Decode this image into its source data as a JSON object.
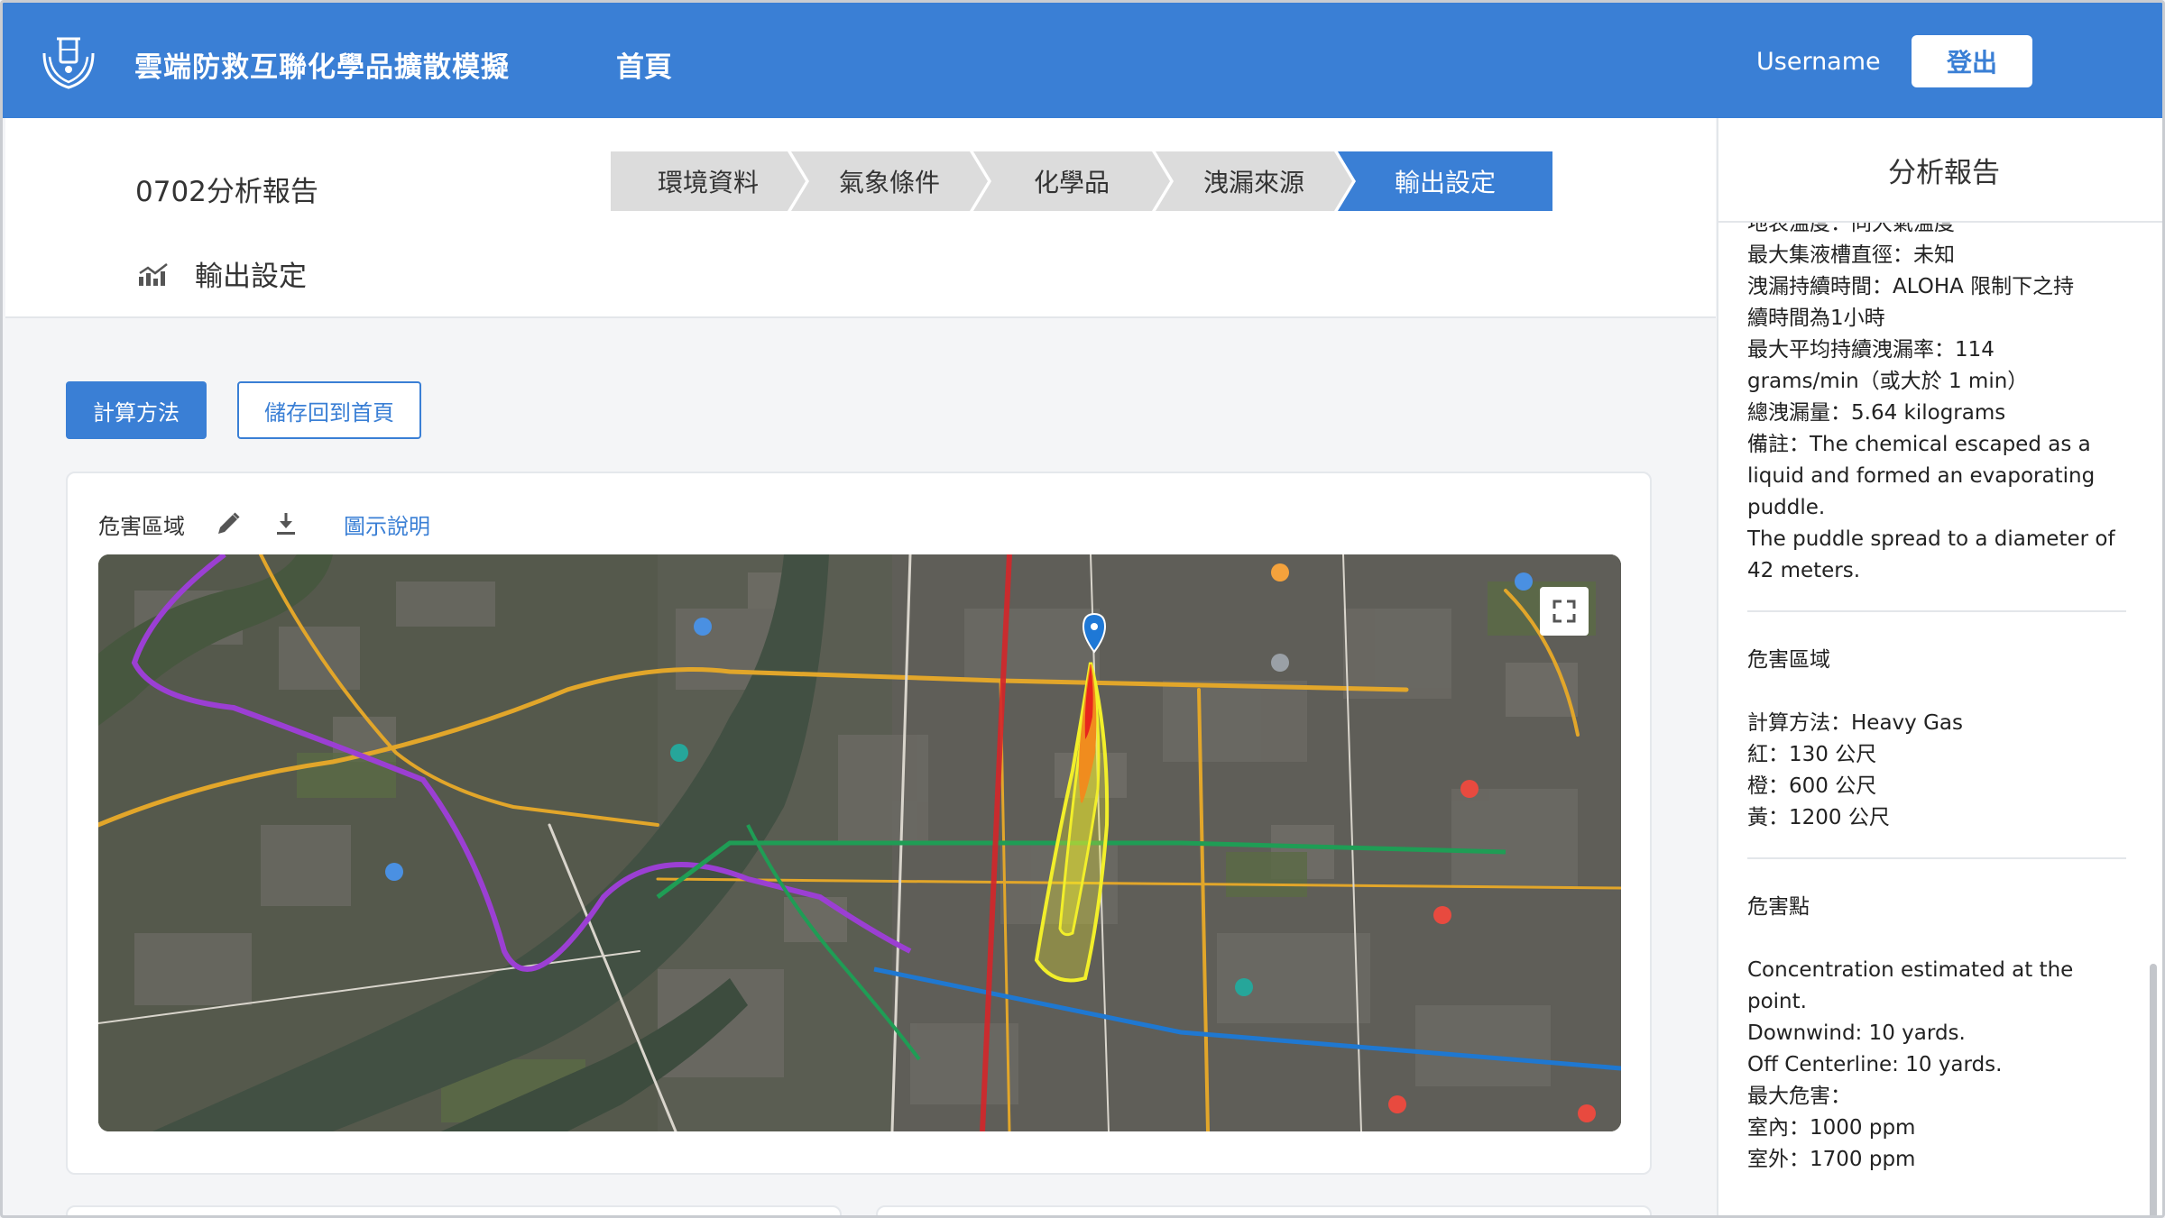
{
  "header": {
    "app_title": "雲端防救互聯化學品擴散模擬",
    "nav_home": "首頁",
    "username": "Username",
    "logout": "登出"
  },
  "page": {
    "report_title": "0702分析報告",
    "section_title": "輸出設定"
  },
  "stepper": {
    "steps": [
      "環境資料",
      "氣象條件",
      "化學品",
      "洩漏來源",
      "輸出設定"
    ],
    "active_index": 4
  },
  "actions": {
    "calc_method": "計算方法",
    "save_home": "儲存回到首頁"
  },
  "map_card": {
    "label": "危害區域",
    "legend_link": "圖示說明",
    "icons": [
      "edit-icon",
      "download-icon",
      "fullscreen-icon"
    ]
  },
  "report_panel": {
    "title": "分析報告",
    "source_lines": [
      "地表溫度：同大氣溫度",
      "最大集液槽直徑：未知",
      "洩漏持續時間：ALOHA 限制下之持",
      "續時間為1小時",
      "最大平均持續洩漏率：114",
      "grams/min（或大於 1 min）",
      "總洩漏量：5.64 kilograms",
      "備註：The chemical escaped as a",
      "liquid and formed an evaporating",
      "puddle.",
      "The puddle spread to a diameter of",
      "42 meters."
    ],
    "hazard_zone": {
      "heading": "危害區域",
      "lines": [
        "計算方法：Heavy Gas",
        "紅：130 公尺",
        "橙：600 公尺",
        "黃：1200 公尺"
      ]
    },
    "hazard_point": {
      "heading": "危害點",
      "lines": [
        "Concentration estimated at the",
        "point.",
        "Downwind: 10 yards.",
        "Off Centerline: 10 yards.",
        "最大危害：",
        "室內：1000 ppm",
        "室外：1700 ppm"
      ]
    }
  },
  "colors": {
    "primary": "#3a7fd5",
    "step_inactive": "#dcdcdc",
    "plume_red": "#e8261c",
    "plume_orange": "#f08c1e",
    "plume_yellow": "#f2ef2a"
  }
}
